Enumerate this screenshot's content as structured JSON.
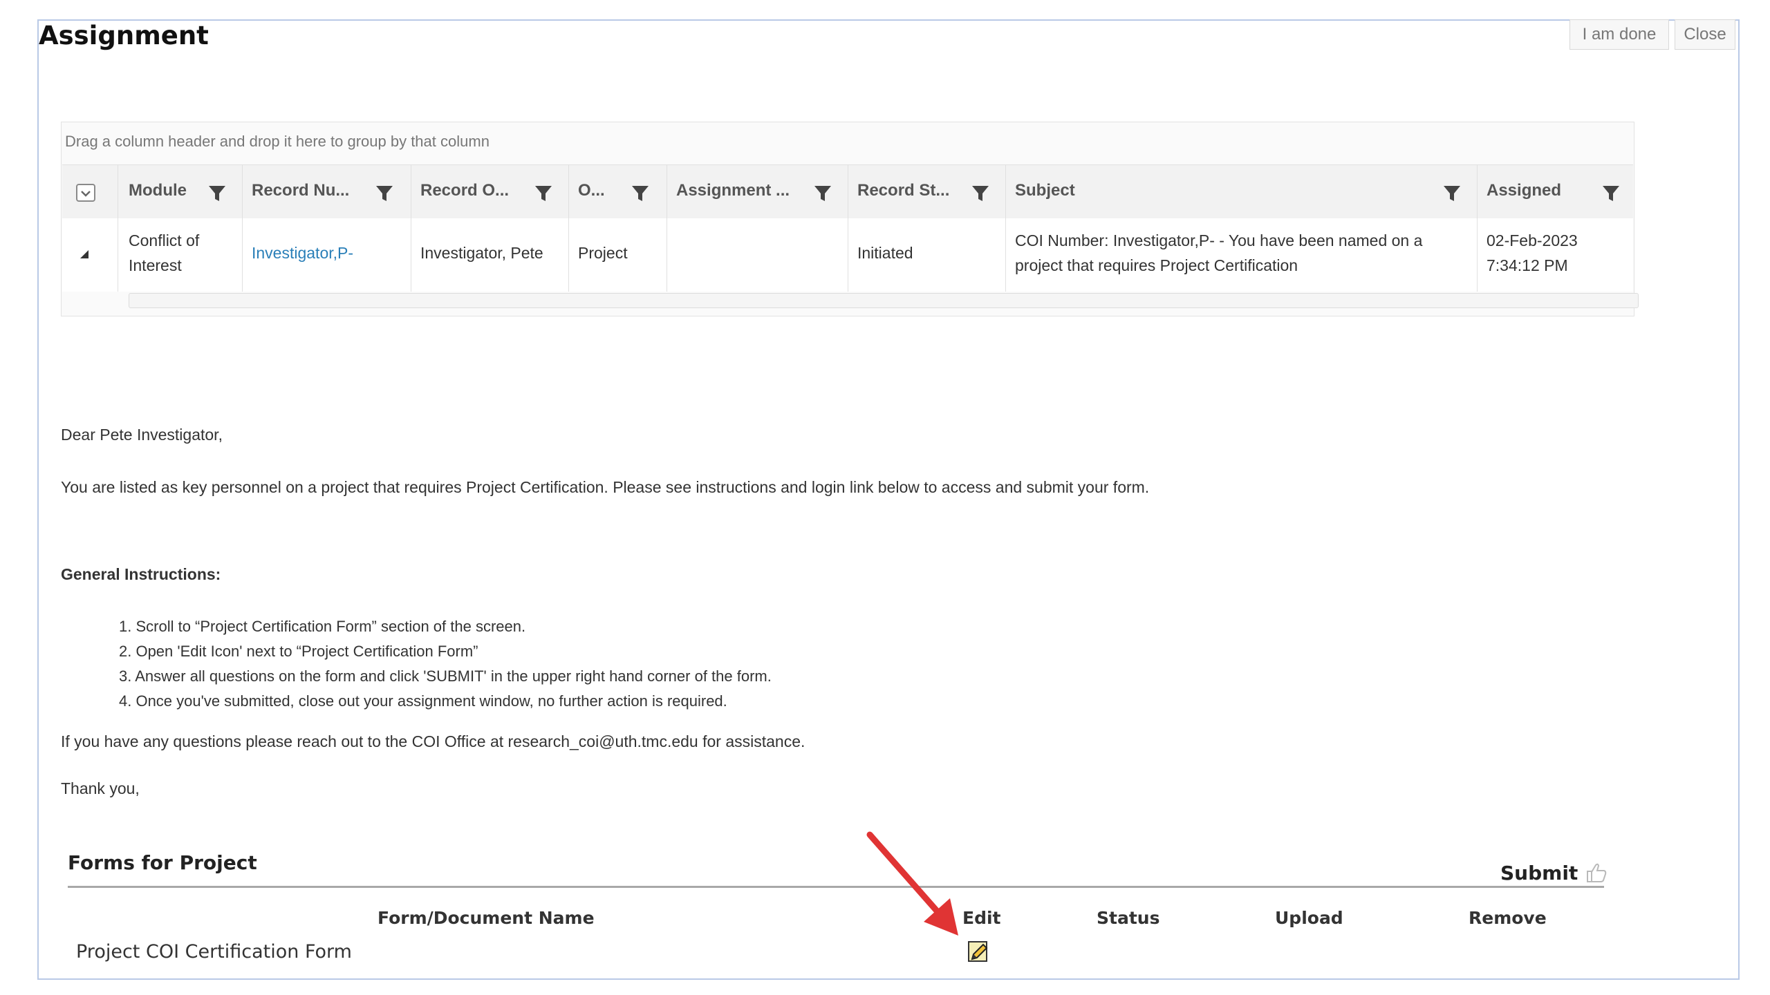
{
  "window": {
    "title": "Assignment",
    "buttons": {
      "done": "I am done",
      "close": "Close"
    }
  },
  "grid": {
    "group_hint": "Drag a column header and drop it here to group by that column",
    "columns": [
      "Module",
      "Record Nu...",
      "Record O...",
      "O...",
      "Assignment ...",
      "Record St...",
      "Subject",
      "Assigned"
    ],
    "row": {
      "module_line1": "Conflict of",
      "module_line2": "Interest",
      "record_number": "Investigator,P-",
      "record_owner": "Investigator, Pete",
      "o": "Project",
      "assignment": "",
      "record_status": "Initiated",
      "subject_line1": "COI Number: Investigator,P- - You have been named on a",
      "subject_line2": "project that requires Project Certification",
      "assigned_date": "02-Feb-2023",
      "assigned_time": "7:34:12 PM"
    }
  },
  "message": {
    "greeting": "Dear Pete Investigator,",
    "intro": "You are listed as key personnel on a project that requires Project Certification. Please see instructions and login link below to access and submit your form.",
    "instructions_heading": "General Instructions:",
    "steps": [
      "1. Scroll to “Project Certification Form” section of the screen.",
      "2. Open 'Edit Icon' next to “Project Certification Form”",
      "3. Answer all questions on the form and click 'SUBMIT' in the upper right hand corner of the form.",
      "4. Once you've submitted, close out your assignment window, no further action is required."
    ],
    "questions": "If you have any questions please reach out to the COI Office at research_coi@uth.tmc.edu for assistance.",
    "thanks": "Thank you,"
  },
  "forms": {
    "title": "Forms for Project",
    "submit_label": "Submit",
    "columns": {
      "name": "Form/Document Name",
      "edit": "Edit",
      "status": "Status",
      "upload": "Upload",
      "remove": "Remove"
    },
    "rows": [
      {
        "name": "Project COI Certification Form"
      }
    ]
  },
  "icons": {
    "filter": "filter-funnel-icon",
    "select_all": "select-all-checkbox-icon",
    "expand": "collapse-triangle-icon",
    "edit": "edit-pencil-icon",
    "submit": "thumbs-up-icon",
    "annotation": "red-arrow"
  },
  "colors": {
    "link": "#2a7fb8",
    "annotation_arrow": "#e03434",
    "frame_border": "#b9c9e6"
  }
}
